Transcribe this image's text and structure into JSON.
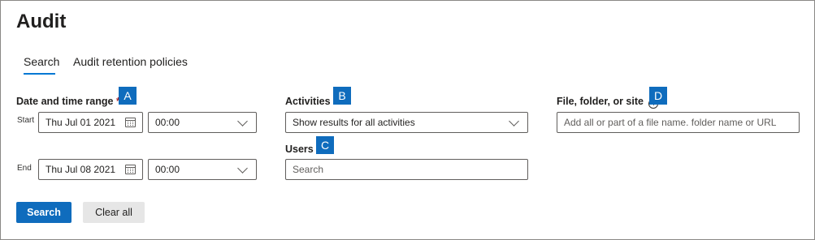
{
  "page": {
    "title": "Audit"
  },
  "tabs": [
    {
      "label": "Search",
      "selected": true
    },
    {
      "label": "Audit retention policies",
      "selected": false
    }
  ],
  "markers": {
    "a": "A",
    "b": "B",
    "c": "C",
    "d": "D"
  },
  "date_range": {
    "label": "Date and time range",
    "required_mark": "*",
    "start": {
      "label": "Start",
      "date": "Thu Jul 01 2021",
      "time": "00:00"
    },
    "end": {
      "label": "End",
      "date": "Thu Jul 08 2021",
      "time": "00:00"
    }
  },
  "activities": {
    "label": "Activities",
    "selected": "Show results for all activities"
  },
  "users": {
    "label": "Users",
    "placeholder": "Search"
  },
  "file_folder_site": {
    "label": "File, folder, or site",
    "info_glyph": "i",
    "placeholder": "Add all or part of a file name. folder name or URL"
  },
  "actions": {
    "search_label": "Search",
    "clear_label": "Clear all"
  },
  "colors": {
    "accent": "#0f6cbd",
    "tab_underline": "#0078d4",
    "required": "#a4262c"
  },
  "icons": {
    "calendar": "calendar-icon",
    "chevron": "chevron-down-icon",
    "info": "info-icon"
  }
}
